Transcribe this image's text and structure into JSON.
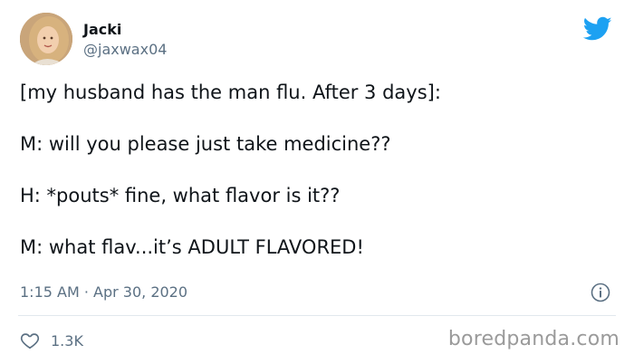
{
  "author": {
    "name": "Jacki",
    "handle": "@jaxwax04"
  },
  "tweet": {
    "lines": [
      "[my husband has the man flu. After 3 days]:",
      "M: will you please just take medicine??",
      "H: *pouts* fine, what flavor is it??",
      "M: what flav...it’s ADULT FLAVORED!"
    ],
    "timestamp": "1:15 AM · Apr 30, 2020"
  },
  "engagement": {
    "likes": "1.3K"
  },
  "watermark": "boredpanda.com",
  "colors": {
    "twitter_blue": "#1da1f2",
    "secondary_text": "#5b7083",
    "divider": "#e1e8ed"
  }
}
